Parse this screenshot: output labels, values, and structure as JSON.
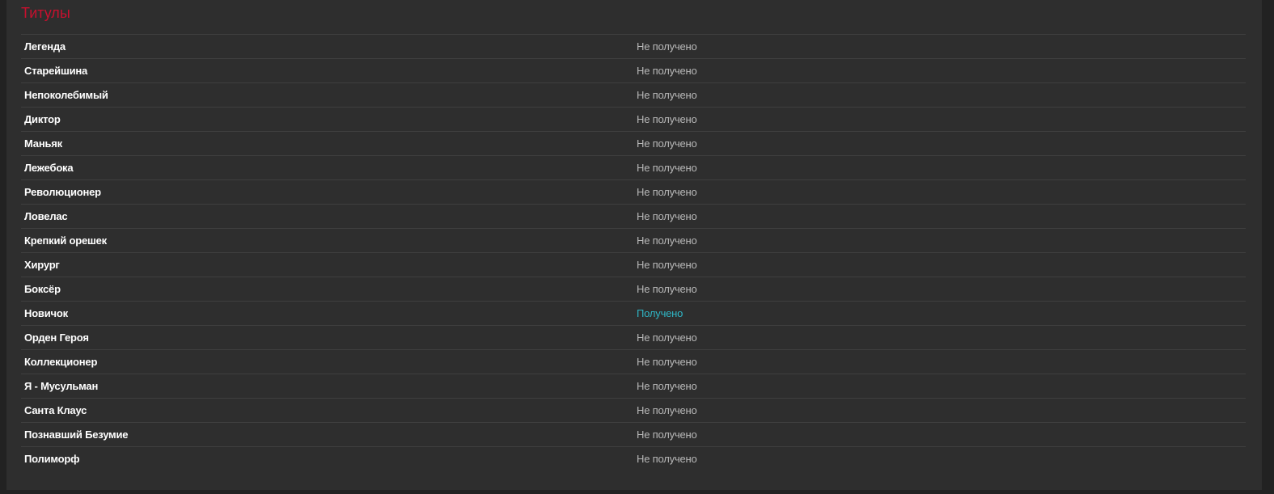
{
  "section": {
    "title": "Титулы",
    "title_color": "#c8102e",
    "earned_color": "#2fb6c6",
    "not_earned_color": "#b9b9b9"
  },
  "titles": [
    {
      "name": "Легенда",
      "status": "Не получено",
      "earned": false
    },
    {
      "name": "Старейшина",
      "status": "Не получено",
      "earned": false
    },
    {
      "name": "Непоколебимый",
      "status": "Не получено",
      "earned": false
    },
    {
      "name": "Диктор",
      "status": "Не получено",
      "earned": false
    },
    {
      "name": "Маньяк",
      "status": "Не получено",
      "earned": false
    },
    {
      "name": "Лежебока",
      "status": "Не получено",
      "earned": false
    },
    {
      "name": "Революционер",
      "status": "Не получено",
      "earned": false
    },
    {
      "name": "Ловелас",
      "status": "Не получено",
      "earned": false
    },
    {
      "name": "Крепкий орешек",
      "status": "Не получено",
      "earned": false
    },
    {
      "name": "Хирург",
      "status": "Не получено",
      "earned": false
    },
    {
      "name": "Боксёр",
      "status": "Не получено",
      "earned": false
    },
    {
      "name": "Новичок",
      "status": "Получено",
      "earned": true
    },
    {
      "name": "Орден Героя",
      "status": "Не получено",
      "earned": false
    },
    {
      "name": "Коллекционер",
      "status": "Не получено",
      "earned": false
    },
    {
      "name": "Я - Мусульман",
      "status": "Не получено",
      "earned": false
    },
    {
      "name": "Санта Клаус",
      "status": "Не получено",
      "earned": false
    },
    {
      "name": "Познавший Безумие",
      "status": "Не получено",
      "earned": false
    },
    {
      "name": "Полиморф",
      "status": "Не получено",
      "earned": false
    }
  ]
}
